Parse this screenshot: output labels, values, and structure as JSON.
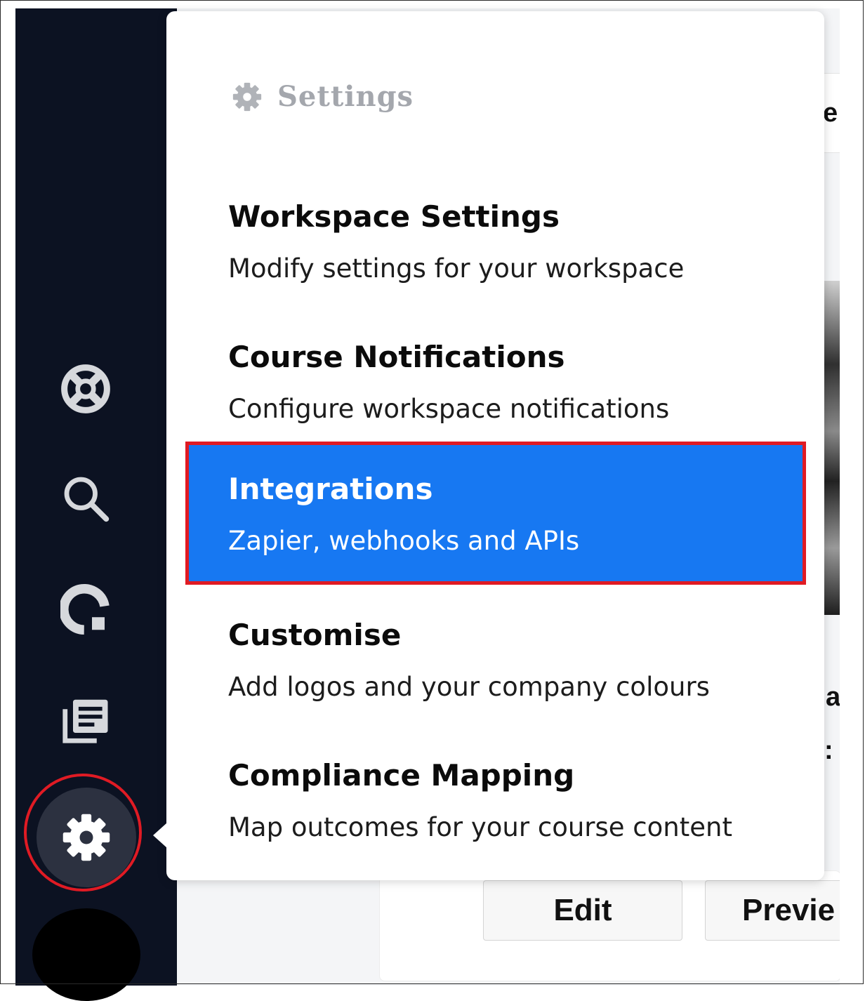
{
  "menu": {
    "header_label": "Settings",
    "header_icon": "gear-icon",
    "items": [
      {
        "title": "Workspace Settings",
        "description": "Modify settings for your workspace"
      },
      {
        "title": "Course Notifications",
        "description": "Configure workspace notifications"
      },
      {
        "title": "Integrations",
        "description": "Zapier, webhooks and APIs",
        "highlighted": true
      },
      {
        "title": "Customise",
        "description": "Add logos and your company colours"
      },
      {
        "title": "Compliance Mapping",
        "description": "Map outcomes for your course content"
      }
    ]
  },
  "sidebar": {
    "icons": [
      "help-lifebuoy-icon",
      "search-icon",
      "analytics-icon",
      "library-icon",
      "gear-icon"
    ]
  },
  "background": {
    "edit_label": "Edit",
    "preview_label": "Previe",
    "partial_letters": [
      "e",
      "a",
      ":"
    ]
  },
  "colors": {
    "sidebar_bg": "#0c1222",
    "highlight_bg": "#1778f2",
    "annotation_red": "#e01b24"
  }
}
